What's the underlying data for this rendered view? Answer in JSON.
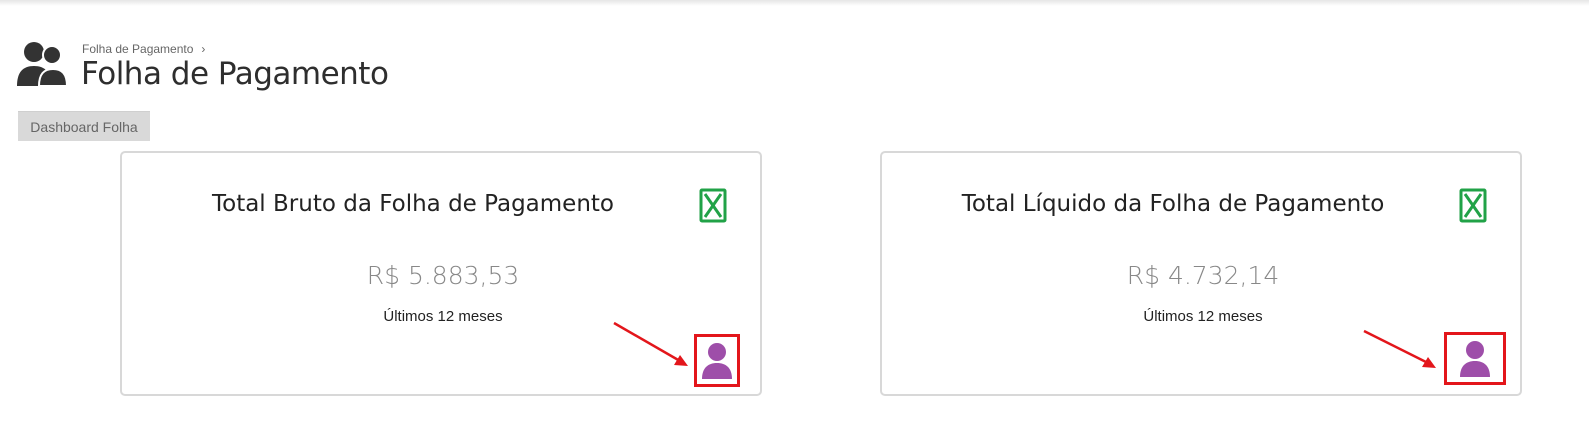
{
  "breadcrumb": {
    "items": [
      "Folha de Pagamento"
    ]
  },
  "page": {
    "title": "Folha de Pagamento"
  },
  "tabs": [
    {
      "label": "Dashboard Folha",
      "active": true
    }
  ],
  "cards": [
    {
      "title": "Total Bruto da Folha de Pagamento",
      "value": "R$ 5.883,53",
      "subtitle": "Últimos 12 meses",
      "excel_icon": "excel-icon",
      "person_icon": "user-icon"
    },
    {
      "title": "Total Líquido da Folha de Pagamento",
      "value": "R$ 4.732,14",
      "subtitle": "Últimos 12 meses",
      "excel_icon": "excel-icon",
      "person_icon": "user-icon"
    }
  ],
  "colors": {
    "excel_green": "#21a247",
    "person_purple": "#9e4ea9",
    "highlight_red": "#e3161b",
    "tab_bg": "#d9d9d9"
  }
}
